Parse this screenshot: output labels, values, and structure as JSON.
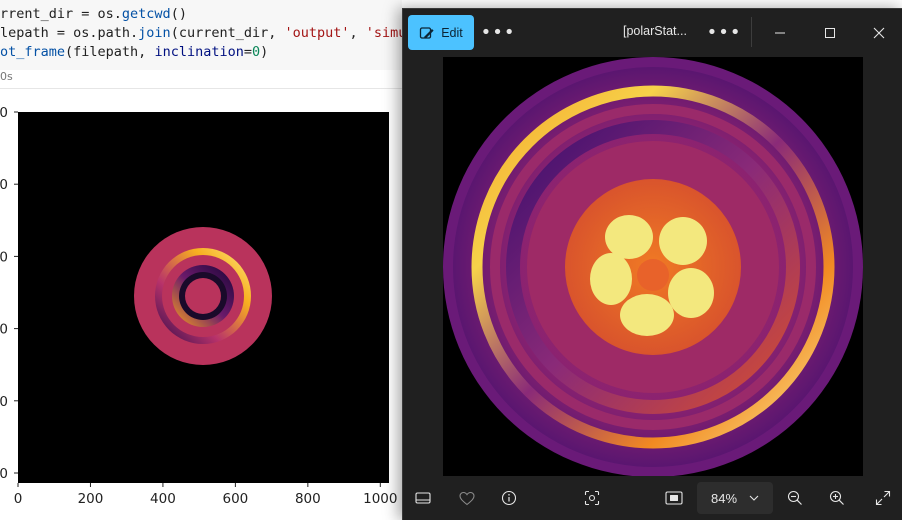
{
  "notebook": {
    "code_lines": [
      [
        {
          "t": "rrent_dir = os.",
          "c": "default"
        },
        {
          "t": "getcwd",
          "c": "fn"
        },
        {
          "t": "()",
          "c": "default"
        }
      ],
      [
        {
          "t": "lepath = os.path.",
          "c": "default"
        },
        {
          "t": "join",
          "c": "fn"
        },
        {
          "t": "(current_dir, ",
          "c": "default"
        },
        {
          "t": "'output'",
          "c": "str"
        },
        {
          "t": ", ",
          "c": "default"
        },
        {
          "t": "'simulat",
          "c": "str"
        }
      ],
      [
        {
          "t": "ot_frame",
          "c": "fn"
        },
        {
          "t": "(filepath, ",
          "c": "default"
        },
        {
          "t": "inclination",
          "c": "kw"
        },
        {
          "t": "=",
          "c": "default"
        },
        {
          "t": "0",
          "c": "num"
        },
        {
          "t": ")",
          "c": "default"
        }
      ]
    ],
    "exec_time": "0s",
    "plot": {
      "x_ticks": [
        "0",
        "200",
        "400",
        "600",
        "800",
        "1000"
      ],
      "y_ticks": [
        "0",
        "0",
        "0",
        "0",
        "0",
        "0"
      ]
    }
  },
  "viewer": {
    "edit_label": "Edit",
    "more_icon": "more-horizontal-icon",
    "filename": "[polarStat...",
    "zoom_value": "84%",
    "colors": {
      "accent": "#4cc2ff",
      "window_bg": "#202020",
      "zoom_bg": "#2d2d2d"
    }
  }
}
